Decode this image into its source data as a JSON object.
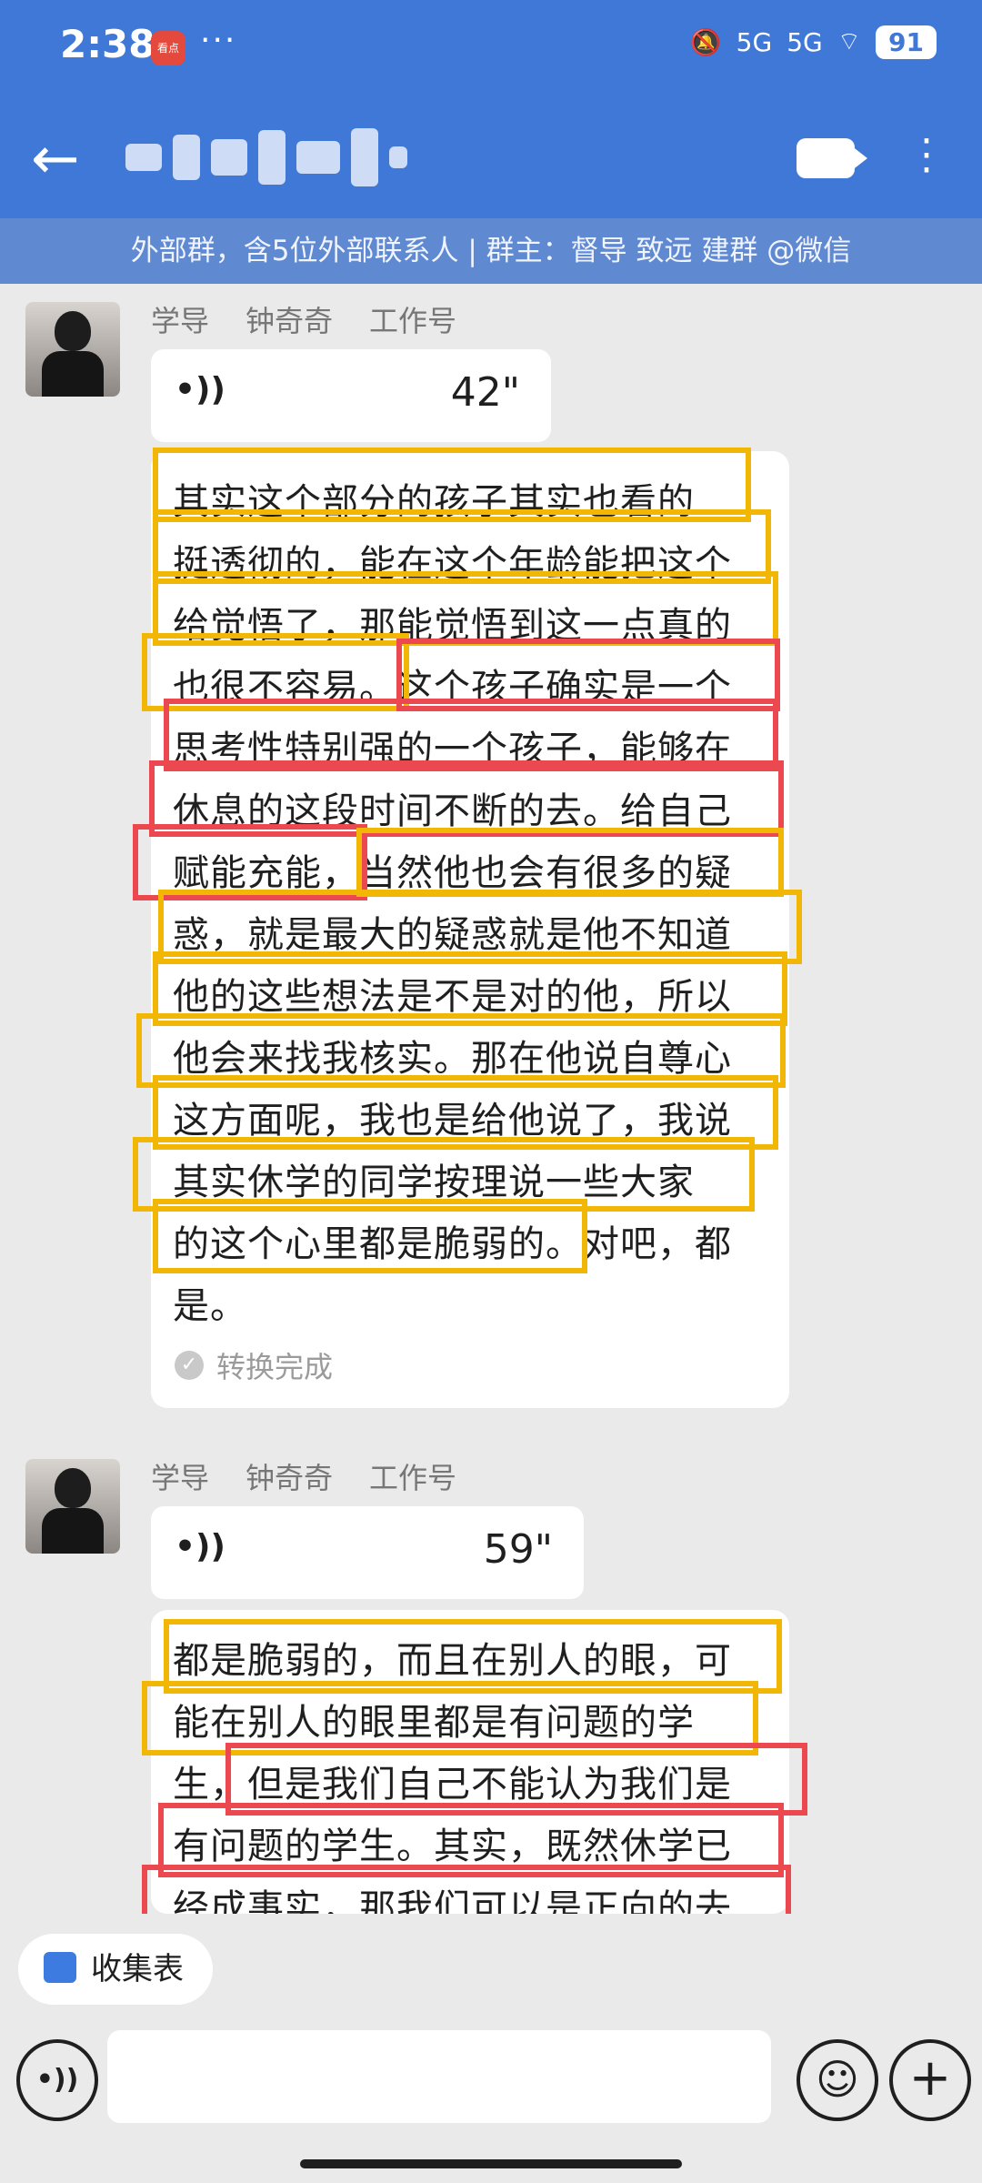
{
  "status": {
    "time": "2:38",
    "app_badge": "看点",
    "dots": "···",
    "signal_a": "5G",
    "signal_b": "5G",
    "battery": "91"
  },
  "header": {
    "group_info": "外部群，含5位外部联系人 | 群主：督导  致远     建群 @微信"
  },
  "messages": [
    {
      "sender": [
        "学导",
        "钟奇奇",
        "工作号"
      ],
      "duration": "42\"",
      "lines": [
        "其实这个部分的孩子其实也看的",
        "挺透彻的，能在这个年龄能把这个",
        "给觉悟了，那能觉悟到这一点真的",
        "也很不容易。这个孩子确实是一个",
        "思考性特别强的一个孩子，能够在",
        "休息的这段时间不断的去。给自己",
        "赋能充能，当然他也会有很多的疑",
        "惑，就是最大的疑惑就是他不知道",
        "他的这些想法是不是对的他，所以",
        "他会来找我核实。那在他说自尊心",
        "这方面呢，我也是给他说了，我说",
        "其实休学的同学按理说一些大家",
        "的这个心里都是脆弱的。对吧，都",
        "是。"
      ],
      "status": "转换完成"
    },
    {
      "sender": [
        "学导",
        "钟奇奇",
        "工作号"
      ],
      "duration": "59\"",
      "lines": [
        "都是脆弱的，而且在别人的眼，可",
        "能在别人的眼里都是有问题的学",
        "生，但是我们自己不能认为我们是",
        "有问题的学生。其实，既然休学已",
        "经成事实，那我们可以是正向的去"
      ]
    }
  ],
  "bottom": {
    "collect_label": "收集表",
    "input_placeholder": ""
  },
  "colors": {
    "accent": "#3f78d6",
    "highlight_yellow": "#f2b705",
    "highlight_red": "#ec4850"
  }
}
